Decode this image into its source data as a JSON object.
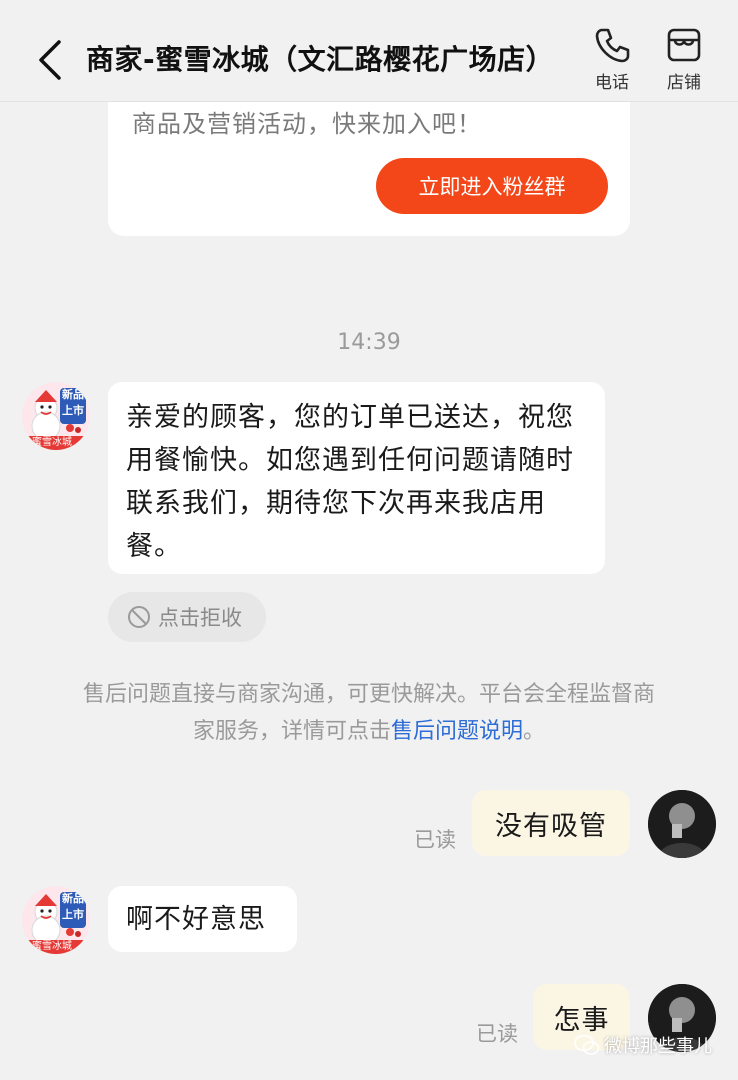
{
  "header": {
    "title": "商家-蜜雪冰城（文汇路樱花广场店）",
    "phone_label": "电话",
    "store_label": "店铺"
  },
  "promo_card": {
    "text": "商品及营销活动，快来加入吧！",
    "join_button": "立即进入粉丝群"
  },
  "timestamp": "14:39",
  "shop_avatar": {
    "badge_top": "新品",
    "badge_bottom": "上市",
    "brand": "蜜雪冰城"
  },
  "messages": {
    "delivered": "亲爱的顾客，您的订单已送达，祝您用餐愉快。如您遇到任何问题请随时联系我们，期待您下次再来我店用餐。",
    "reject_label": "点击拒收",
    "notice_text": "售后问题直接与商家沟通，可更快解决。平台会全程监督商家服务，详情可点击",
    "notice_link": "售后问题说明",
    "notice_end": "。",
    "user_msg_1": "没有吸管",
    "read_1": "已读",
    "shop_reply": "啊不好意思",
    "user_msg_2": "怎事",
    "read_2": "已读"
  },
  "watermark": "微博那些事儿",
  "colors": {
    "accent": "#f3471a",
    "link": "#2d6dd6",
    "outgoing_bubble": "#fbf6e4",
    "background": "#f1f1f1"
  }
}
